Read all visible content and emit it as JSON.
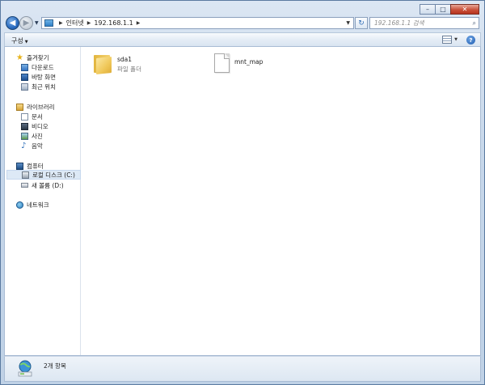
{
  "window": {
    "minimize_label": "–",
    "maximize_label": "□",
    "close_label": "✕"
  },
  "nav": {
    "back_label": "◀",
    "forward_label": "▶",
    "refresh_label": "↻",
    "breadcrumbs": [
      "인터넷",
      "192.168.1.1"
    ],
    "search_placeholder": "192.168.1.1 검색"
  },
  "toolbar": {
    "organize_label": "구성",
    "help_label": "?"
  },
  "sidebar": {
    "groups": [
      {
        "label": "즐겨찾기",
        "icon": "star-icon",
        "items": [
          {
            "label": "다운로드",
            "icon": "downloads-icon"
          },
          {
            "label": "바탕 화면",
            "icon": "desktop-icon"
          },
          {
            "label": "최근 위치",
            "icon": "recent-places-icon"
          }
        ]
      },
      {
        "label": "라이브러리",
        "icon": "libraries-icon",
        "items": [
          {
            "label": "문서",
            "icon": "documents-icon"
          },
          {
            "label": "비디오",
            "icon": "videos-icon"
          },
          {
            "label": "사진",
            "icon": "pictures-icon"
          },
          {
            "label": "음악",
            "icon": "music-icon"
          }
        ]
      },
      {
        "label": "컴퓨터",
        "icon": "computer-icon",
        "items": [
          {
            "label": "로컬 디스크 (C:)",
            "icon": "local-disk-icon"
          },
          {
            "label": "새 볼륨 (D:)",
            "icon": "volume-icon"
          }
        ]
      },
      {
        "label": "네트워크",
        "icon": "network-icon",
        "items": []
      }
    ]
  },
  "files": [
    {
      "name": "sda1",
      "type": "파일 폴더",
      "icon": "folder-icon"
    },
    {
      "name": "mnt_map",
      "type": "",
      "icon": "file-icon"
    }
  ],
  "status": {
    "item_count": "2개 항목"
  },
  "colors": {
    "chrome": "#c7d7ea",
    "selection": "#dde9f6",
    "close": "#c9513a"
  }
}
